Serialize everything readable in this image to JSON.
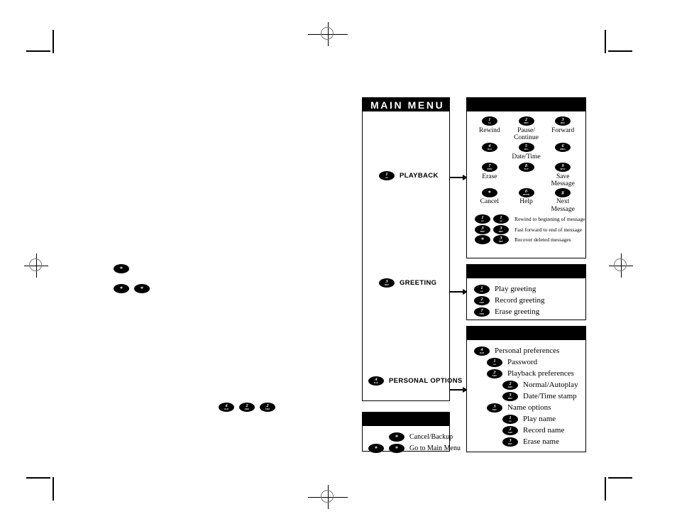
{
  "document": {
    "title": "MAIN MENU",
    "type": "voicemail-quick-reference-diagram"
  },
  "main_menu": {
    "header": "MAIN MENU",
    "items": [
      {
        "key": "1",
        "key_sub": "oo",
        "label": "PLAYBACK"
      },
      {
        "key": "3",
        "key_sub": "DEF",
        "label": "GREETING"
      },
      {
        "key": "4",
        "key_sub": "GHI",
        "label": "PERSONAL OPTIONS"
      }
    ]
  },
  "playback_panel": {
    "keypad": [
      [
        {
          "key": "1",
          "key_sub": "oo",
          "caption": "Rewind"
        },
        {
          "key": "2",
          "key_sub": "ABC",
          "caption": "Pause/\nContinue"
        },
        {
          "key": "3",
          "key_sub": "DEF",
          "caption": "Forward"
        }
      ],
      [
        {
          "key": "4",
          "key_sub": "GHI",
          "caption": ""
        },
        {
          "key": "5",
          "key_sub": "JKL",
          "caption": "Date/Time"
        },
        {
          "key": "6",
          "key_sub": "MNO",
          "caption": ""
        }
      ],
      [
        {
          "key": "7",
          "key_sub": "PRS",
          "caption": "Erase"
        },
        {
          "key": "8",
          "key_sub": "TUV",
          "caption": ""
        },
        {
          "key": "9",
          "key_sub": "WXY",
          "caption": "Save Message"
        }
      ],
      [
        {
          "key": "*",
          "key_sub": "",
          "caption": "Cancel"
        },
        {
          "key": "0",
          "key_sub": "OPER",
          "caption": "Help"
        },
        {
          "key": "#",
          "key_sub": "",
          "caption": "Next Message"
        }
      ]
    ],
    "notes": [
      {
        "keys": [
          {
            "key": "1",
            "key_sub": "oo"
          },
          {
            "key": "1",
            "key_sub": "oo"
          }
        ],
        "text": "Rewind to beginning of message"
      },
      {
        "keys": [
          {
            "key": "3",
            "key_sub": "DEF"
          },
          {
            "key": "3",
            "key_sub": "DEF"
          }
        ],
        "text": "Fast forward to end of message"
      },
      {
        "keys": [
          {
            "key": "*",
            "key_sub": ""
          },
          {
            "key": "3",
            "key_sub": "DEF"
          }
        ],
        "text": "Recover deleted messages"
      }
    ]
  },
  "greeting_panel": {
    "items": [
      {
        "key": "1",
        "key_sub": "oo",
        "label": "Play greeting",
        "indent": 0
      },
      {
        "key": "2",
        "key_sub": "ABC",
        "label": "Record greeting",
        "indent": 0
      },
      {
        "key": "7",
        "key_sub": "PRS",
        "label": "Erase greeting",
        "indent": 0
      }
    ]
  },
  "options_panel": {
    "items": [
      {
        "key": "4",
        "key_sub": "GHI",
        "label": "Personal preferences",
        "indent": 0
      },
      {
        "key": "1",
        "key_sub": "oo",
        "label": "Password",
        "indent": 1
      },
      {
        "key": "2",
        "key_sub": "ABC",
        "label": "Playback preferences",
        "indent": 1
      },
      {
        "key": "2",
        "key_sub": "ABC",
        "label": "Normal/Autoplay",
        "indent": 2
      },
      {
        "key": "3",
        "key_sub": "DEF",
        "label": "Date/Time stamp",
        "indent": 2
      },
      {
        "key": "3",
        "key_sub": "DEF",
        "label": "Name options",
        "indent": 1
      },
      {
        "key": "1",
        "key_sub": "oo",
        "label": "Play name",
        "indent": 2
      },
      {
        "key": "2",
        "key_sub": "ABC",
        "label": "Record name",
        "indent": 2
      },
      {
        "key": "3",
        "key_sub": "DEF",
        "label": "Erase name",
        "indent": 2
      }
    ]
  },
  "cancel_panel": {
    "items": [
      {
        "keys": [
          {
            "key": "*",
            "key_sub": ""
          }
        ],
        "label": "Cancel/Backup"
      },
      {
        "keys": [
          {
            "key": "*",
            "key_sub": ""
          },
          {
            "key": "*",
            "key_sub": ""
          }
        ],
        "label": "Go to Main Menu"
      }
    ]
  },
  "loose_keys": [
    {
      "id": "star-single",
      "keys": [
        {
          "key": "*",
          "key_sub": ""
        }
      ]
    },
    {
      "id": "star-double",
      "keys": [
        {
          "key": "*",
          "key_sub": ""
        },
        {
          "key": "*",
          "key_sub": ""
        }
      ]
    },
    {
      "id": "four-two-two",
      "keys": [
        {
          "key": "4",
          "key_sub": "GHI"
        },
        {
          "key": "2",
          "key_sub": "ABC"
        },
        {
          "key": "2",
          "key_sub": "ABC"
        }
      ]
    }
  ],
  "colors": {
    "ink": "#000000",
    "paper": "#ffffff",
    "registration_ring": "#7a7a7a"
  }
}
